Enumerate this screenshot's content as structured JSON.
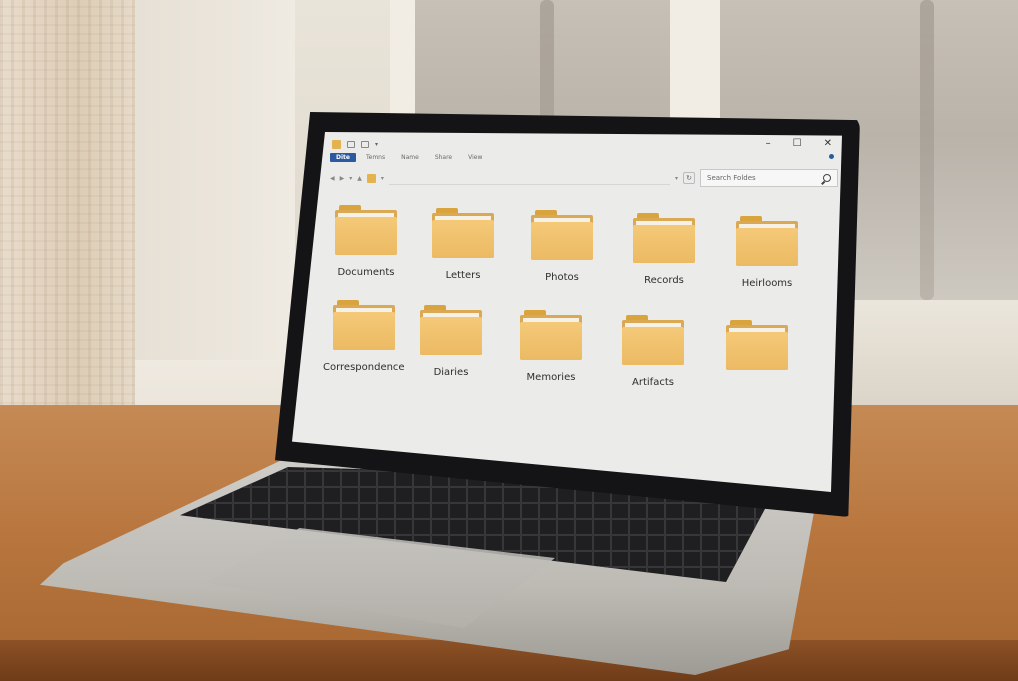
{
  "ribbon": {
    "tabs": [
      "Dite",
      "Temns",
      "Name",
      "Share",
      "View"
    ],
    "active_tab": "Dite"
  },
  "address": {
    "search_placeholder": "Search Foldes"
  },
  "icons": {
    "refresh": "refresh-icon",
    "search": "search-icon",
    "folder": "folder-icon"
  },
  "window_controls": {
    "minimize": "–",
    "maximize": "☐",
    "close": "✕"
  },
  "folders": [
    {
      "label": "Documents"
    },
    {
      "label": "Letters"
    },
    {
      "label": "Photos"
    },
    {
      "label": "Records"
    },
    {
      "label": "Heirlooms"
    },
    {
      "label": "Correspondence"
    },
    {
      "label": "Diaries"
    },
    {
      "label": "Memories"
    },
    {
      "label": "Artifacts"
    },
    {
      "label": ""
    }
  ],
  "colors": {
    "accent": "#2b5aa0",
    "folder": "#ecba63"
  }
}
